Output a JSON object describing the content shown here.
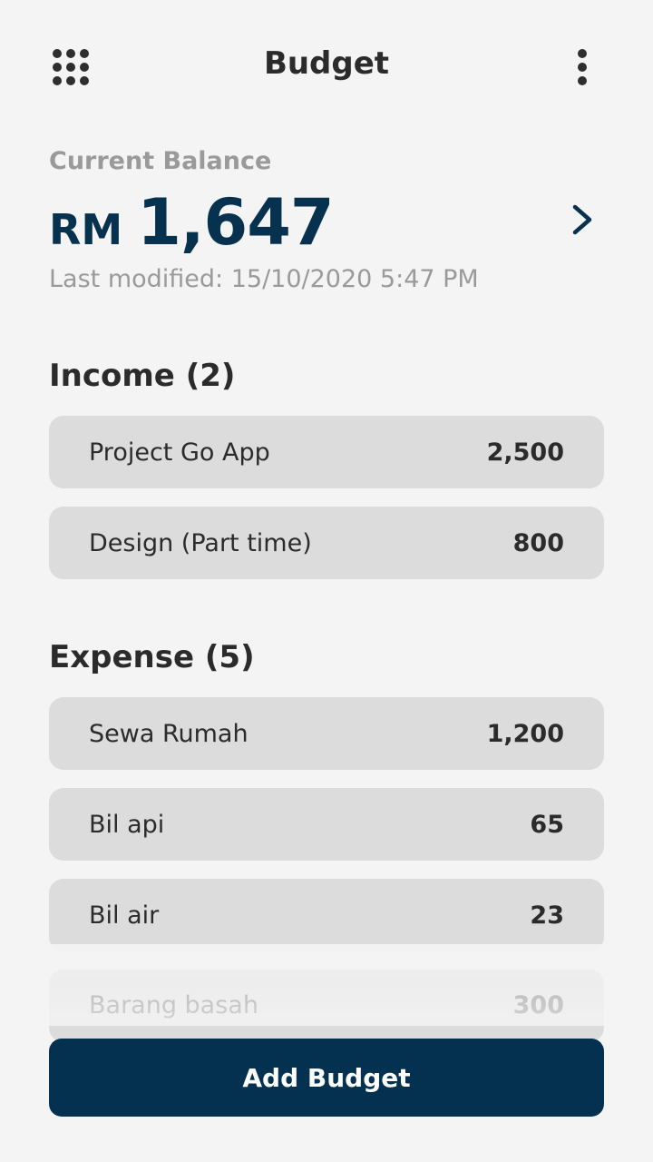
{
  "header": {
    "title": "Budget",
    "menu_icon": "grid-menu-icon",
    "more_icon": "more-vertical-icon"
  },
  "balance": {
    "label": "Current Balance",
    "currency": "RM",
    "amount": "1,647",
    "last_modified": "Last modified: 15/10/2020 5:47 PM",
    "detail_icon": "chevron-right-icon"
  },
  "income": {
    "title": "Income (2)",
    "items": [
      {
        "label": "Project Go App",
        "value": "2,500"
      },
      {
        "label": "Design (Part time)",
        "value": "800"
      }
    ]
  },
  "expense": {
    "title": "Expense (5)",
    "items": [
      {
        "label": "Sewa Rumah",
        "value": "1,200"
      },
      {
        "label": "Bil api",
        "value": "65"
      },
      {
        "label": "Bil air",
        "value": "23"
      },
      {
        "label": "Barang basah",
        "value": "300"
      }
    ]
  },
  "actions": {
    "add_label": "Add Budget"
  },
  "colors": {
    "accent": "#04314f",
    "background": "#f4f4f4",
    "card": "#dcdcdc",
    "muted_text": "#9a9a9a"
  }
}
